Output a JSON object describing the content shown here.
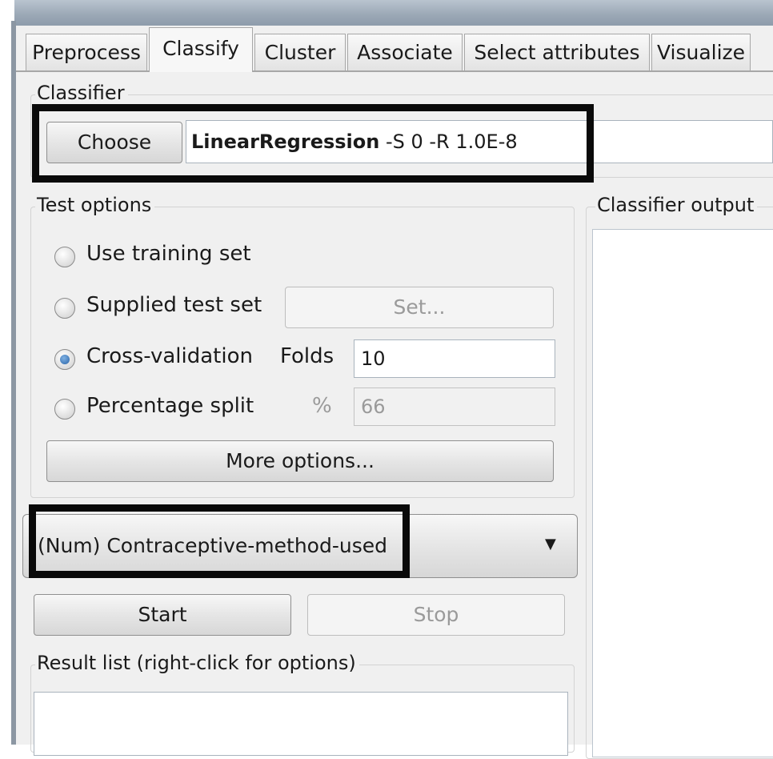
{
  "tabs": [
    {
      "label": "Preprocess"
    },
    {
      "label": "Classify"
    },
    {
      "label": "Cluster"
    },
    {
      "label": "Associate"
    },
    {
      "label": "Select attributes"
    },
    {
      "label": "Visualize"
    }
  ],
  "classifier": {
    "legend": "Classifier",
    "choose_label": "Choose",
    "name": "LinearRegression",
    "options": " -S 0 -R 1.0E-8"
  },
  "test_options": {
    "legend": "Test options",
    "use_training": "Use training set",
    "supplied": "Supplied test set",
    "set_label": "Set...",
    "cross_validation": "Cross-validation",
    "folds_label": "Folds",
    "folds_value": "10",
    "percentage_split": "Percentage split",
    "percent_label": "%",
    "percent_value": "66",
    "more_options": "More options...",
    "selected": "cross_validation"
  },
  "class_select": {
    "value": "(Num) Contraceptive-method-used"
  },
  "actions": {
    "start": "Start",
    "stop": "Stop"
  },
  "result_list": {
    "legend": "Result list (right-click for options)"
  },
  "output": {
    "legend": "Classifier output"
  }
}
